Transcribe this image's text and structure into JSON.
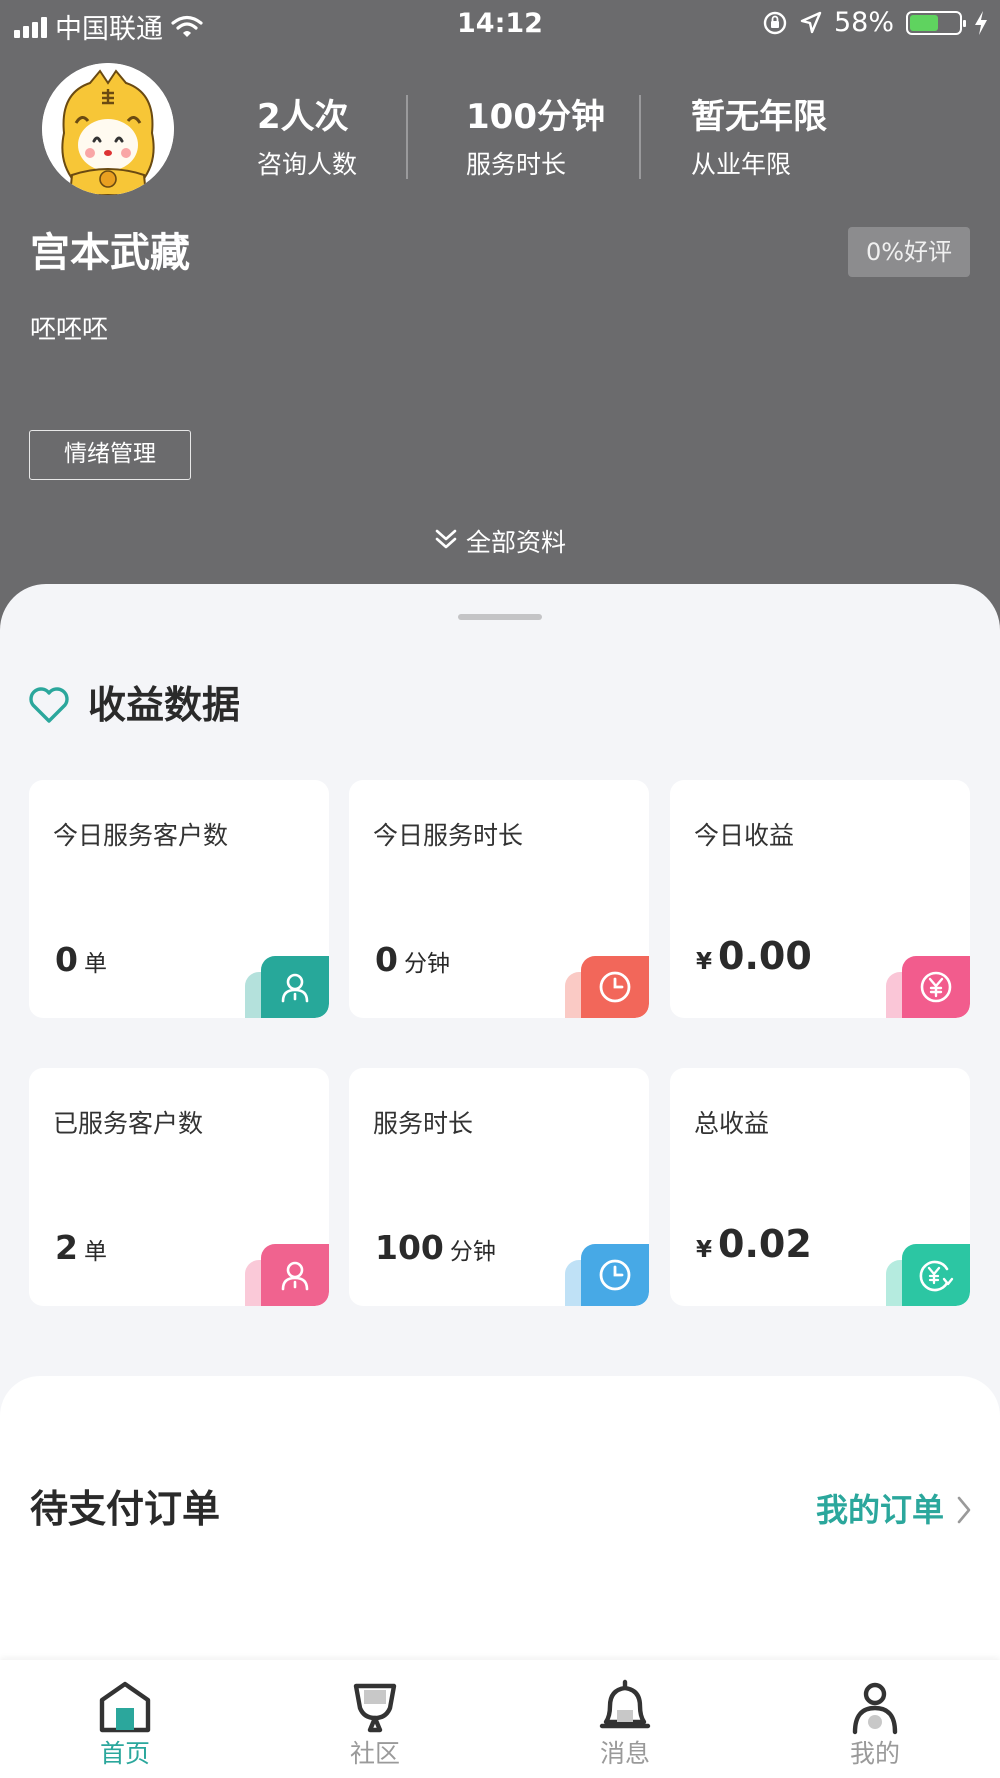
{
  "status_bar": {
    "carrier": "中国联通",
    "time": "14:12",
    "battery": "58%",
    "battery_level": 0.58
  },
  "profile": {
    "stats": [
      {
        "value": "2人次",
        "label": "咨询人数"
      },
      {
        "value": "100分钟",
        "label": "服务时长"
      },
      {
        "value": "暂无年限",
        "label": "从业年限"
      }
    ],
    "name": "宫本武藏",
    "rating": "0%好评",
    "bio": "呸呸呸",
    "tag": "情绪管理",
    "expand_label": "全部资料"
  },
  "earnings": {
    "title": "收益数据",
    "cards": [
      {
        "label": "今日服务客户数",
        "value": "0",
        "unit": "单",
        "icon": "user-icon",
        "color": "#27a89a"
      },
      {
        "label": "今日服务时长",
        "value": "0",
        "unit": "分钟",
        "icon": "clock-icon",
        "color": "#f2675a"
      },
      {
        "label": "今日收益",
        "currency": "¥",
        "value": "0.00",
        "icon": "yen-coin-icon",
        "color": "#f25c8d"
      },
      {
        "label": "已服务客户数",
        "value": "2",
        "unit": "单",
        "icon": "user-icon",
        "color": "#f0638f"
      },
      {
        "label": "服务时长",
        "value": "100",
        "unit": "分钟",
        "icon": "clock-icon",
        "color": "#47a9e6"
      },
      {
        "label": "总收益",
        "currency": "¥",
        "value": "0.02",
        "icon": "yen-refresh-icon",
        "color": "#2cc6a3"
      }
    ]
  },
  "orders": {
    "title": "待支付订单",
    "link": "我的订单"
  },
  "tabbar": {
    "items": [
      {
        "label": "首页",
        "icon": "home-icon",
        "active": true
      },
      {
        "label": "社区",
        "icon": "community-icon",
        "active": false
      },
      {
        "label": "消息",
        "icon": "bell-icon",
        "active": false
      },
      {
        "label": "我的",
        "icon": "person-icon",
        "active": false
      }
    ]
  },
  "colors": {
    "accent": "#2ba79c",
    "header_bg": "#6b6b6d",
    "page_bg": "#F4F5F8"
  }
}
